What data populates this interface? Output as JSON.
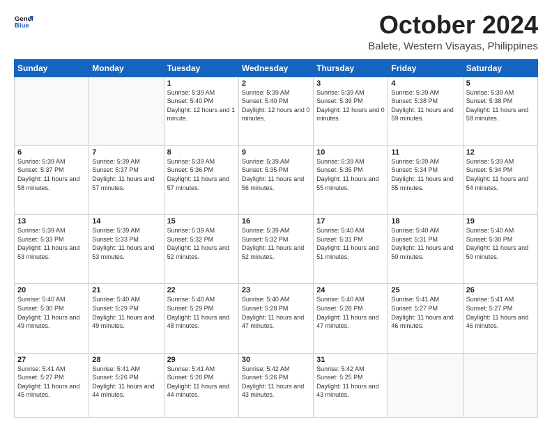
{
  "header": {
    "logo_line1": "General",
    "logo_line2": "Blue",
    "month": "October 2024",
    "location": "Balete, Western Visayas, Philippines"
  },
  "weekdays": [
    "Sunday",
    "Monday",
    "Tuesday",
    "Wednesday",
    "Thursday",
    "Friday",
    "Saturday"
  ],
  "weeks": [
    [
      {
        "day": "",
        "sunrise": "",
        "sunset": "",
        "daylight": ""
      },
      {
        "day": "",
        "sunrise": "",
        "sunset": "",
        "daylight": ""
      },
      {
        "day": "1",
        "sunrise": "Sunrise: 5:39 AM",
        "sunset": "Sunset: 5:40 PM",
        "daylight": "Daylight: 12 hours and 1 minute."
      },
      {
        "day": "2",
        "sunrise": "Sunrise: 5:39 AM",
        "sunset": "Sunset: 5:40 PM",
        "daylight": "Daylight: 12 hours and 0 minutes."
      },
      {
        "day": "3",
        "sunrise": "Sunrise: 5:39 AM",
        "sunset": "Sunset: 5:39 PM",
        "daylight": "Daylight: 12 hours and 0 minutes."
      },
      {
        "day": "4",
        "sunrise": "Sunrise: 5:39 AM",
        "sunset": "Sunset: 5:38 PM",
        "daylight": "Daylight: 11 hours and 59 minutes."
      },
      {
        "day": "5",
        "sunrise": "Sunrise: 5:39 AM",
        "sunset": "Sunset: 5:38 PM",
        "daylight": "Daylight: 11 hours and 58 minutes."
      }
    ],
    [
      {
        "day": "6",
        "sunrise": "Sunrise: 5:39 AM",
        "sunset": "Sunset: 5:37 PM",
        "daylight": "Daylight: 11 hours and 58 minutes."
      },
      {
        "day": "7",
        "sunrise": "Sunrise: 5:39 AM",
        "sunset": "Sunset: 5:37 PM",
        "daylight": "Daylight: 11 hours and 57 minutes."
      },
      {
        "day": "8",
        "sunrise": "Sunrise: 5:39 AM",
        "sunset": "Sunset: 5:36 PM",
        "daylight": "Daylight: 11 hours and 57 minutes."
      },
      {
        "day": "9",
        "sunrise": "Sunrise: 5:39 AM",
        "sunset": "Sunset: 5:35 PM",
        "daylight": "Daylight: 11 hours and 56 minutes."
      },
      {
        "day": "10",
        "sunrise": "Sunrise: 5:39 AM",
        "sunset": "Sunset: 5:35 PM",
        "daylight": "Daylight: 11 hours and 55 minutes."
      },
      {
        "day": "11",
        "sunrise": "Sunrise: 5:39 AM",
        "sunset": "Sunset: 5:34 PM",
        "daylight": "Daylight: 11 hours and 55 minutes."
      },
      {
        "day": "12",
        "sunrise": "Sunrise: 5:39 AM",
        "sunset": "Sunset: 5:34 PM",
        "daylight": "Daylight: 11 hours and 54 minutes."
      }
    ],
    [
      {
        "day": "13",
        "sunrise": "Sunrise: 5:39 AM",
        "sunset": "Sunset: 5:33 PM",
        "daylight": "Daylight: 11 hours and 53 minutes."
      },
      {
        "day": "14",
        "sunrise": "Sunrise: 5:39 AM",
        "sunset": "Sunset: 5:33 PM",
        "daylight": "Daylight: 11 hours and 53 minutes."
      },
      {
        "day": "15",
        "sunrise": "Sunrise: 5:39 AM",
        "sunset": "Sunset: 5:32 PM",
        "daylight": "Daylight: 11 hours and 52 minutes."
      },
      {
        "day": "16",
        "sunrise": "Sunrise: 5:39 AM",
        "sunset": "Sunset: 5:32 PM",
        "daylight": "Daylight: 11 hours and 52 minutes."
      },
      {
        "day": "17",
        "sunrise": "Sunrise: 5:40 AM",
        "sunset": "Sunset: 5:31 PM",
        "daylight": "Daylight: 11 hours and 51 minutes."
      },
      {
        "day": "18",
        "sunrise": "Sunrise: 5:40 AM",
        "sunset": "Sunset: 5:31 PM",
        "daylight": "Daylight: 11 hours and 50 minutes."
      },
      {
        "day": "19",
        "sunrise": "Sunrise: 5:40 AM",
        "sunset": "Sunset: 5:30 PM",
        "daylight": "Daylight: 11 hours and 50 minutes."
      }
    ],
    [
      {
        "day": "20",
        "sunrise": "Sunrise: 5:40 AM",
        "sunset": "Sunset: 5:30 PM",
        "daylight": "Daylight: 11 hours and 49 minutes."
      },
      {
        "day": "21",
        "sunrise": "Sunrise: 5:40 AM",
        "sunset": "Sunset: 5:29 PM",
        "daylight": "Daylight: 11 hours and 49 minutes."
      },
      {
        "day": "22",
        "sunrise": "Sunrise: 5:40 AM",
        "sunset": "Sunset: 5:29 PM",
        "daylight": "Daylight: 11 hours and 48 minutes."
      },
      {
        "day": "23",
        "sunrise": "Sunrise: 5:40 AM",
        "sunset": "Sunset: 5:28 PM",
        "daylight": "Daylight: 11 hours and 47 minutes."
      },
      {
        "day": "24",
        "sunrise": "Sunrise: 5:40 AM",
        "sunset": "Sunset: 5:28 PM",
        "daylight": "Daylight: 11 hours and 47 minutes."
      },
      {
        "day": "25",
        "sunrise": "Sunrise: 5:41 AM",
        "sunset": "Sunset: 5:27 PM",
        "daylight": "Daylight: 11 hours and 46 minutes."
      },
      {
        "day": "26",
        "sunrise": "Sunrise: 5:41 AM",
        "sunset": "Sunset: 5:27 PM",
        "daylight": "Daylight: 11 hours and 46 minutes."
      }
    ],
    [
      {
        "day": "27",
        "sunrise": "Sunrise: 5:41 AM",
        "sunset": "Sunset: 5:27 PM",
        "daylight": "Daylight: 11 hours and 45 minutes."
      },
      {
        "day": "28",
        "sunrise": "Sunrise: 5:41 AM",
        "sunset": "Sunset: 5:26 PM",
        "daylight": "Daylight: 11 hours and 44 minutes."
      },
      {
        "day": "29",
        "sunrise": "Sunrise: 5:41 AM",
        "sunset": "Sunset: 5:26 PM",
        "daylight": "Daylight: 11 hours and 44 minutes."
      },
      {
        "day": "30",
        "sunrise": "Sunrise: 5:42 AM",
        "sunset": "Sunset: 5:26 PM",
        "daylight": "Daylight: 11 hours and 43 minutes."
      },
      {
        "day": "31",
        "sunrise": "Sunrise: 5:42 AM",
        "sunset": "Sunset: 5:25 PM",
        "daylight": "Daylight: 11 hours and 43 minutes."
      },
      {
        "day": "",
        "sunrise": "",
        "sunset": "",
        "daylight": ""
      },
      {
        "day": "",
        "sunrise": "",
        "sunset": "",
        "daylight": ""
      }
    ]
  ]
}
